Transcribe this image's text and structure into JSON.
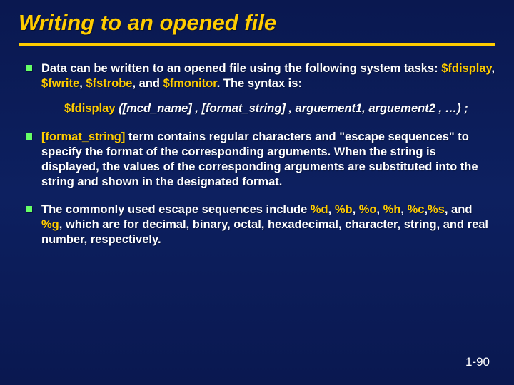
{
  "title": "Writing to an opened file",
  "bullets": {
    "b1_pre": "Data can be written to an opened file using the following system tasks: ",
    "t1": "$fdisplay",
    "sep1": ", ",
    "t2": "$fwrite",
    "sep2": ", ",
    "t3": "$fstrobe",
    "sep3": ", and ",
    "t4": "$fmonitor",
    "b1_post": ". The syntax is:",
    "syntax_kw": "$fdisplay",
    "syntax_rest": " ([mcd_name] , [format_string] , arguement1, arguement2 , …) ;",
    "b2_lead": "[format_string]",
    "b2_rest": " term contains regular characters and \"escape sequences\" to specify the format of the corresponding arguments. When the string is displayed, the values of the corresponding arguments are substituted into the string and shown in the designated format.",
    "b3_pre": "The commonly used escape sequences include ",
    "e1": "%d",
    "c1": ", ",
    "e2": "%b",
    "c2": ", ",
    "e3": "%o",
    "c3": ", ",
    "e4": "%h",
    "c4": ", ",
    "e5": "%c",
    "c5": ",",
    "e6": "%s",
    "c6": ", and ",
    "e7": "%g",
    "b3_post": ", which are for decimal, binary, octal, hexadecimal, character, string, and real number, respectively."
  },
  "footer": "1-90"
}
